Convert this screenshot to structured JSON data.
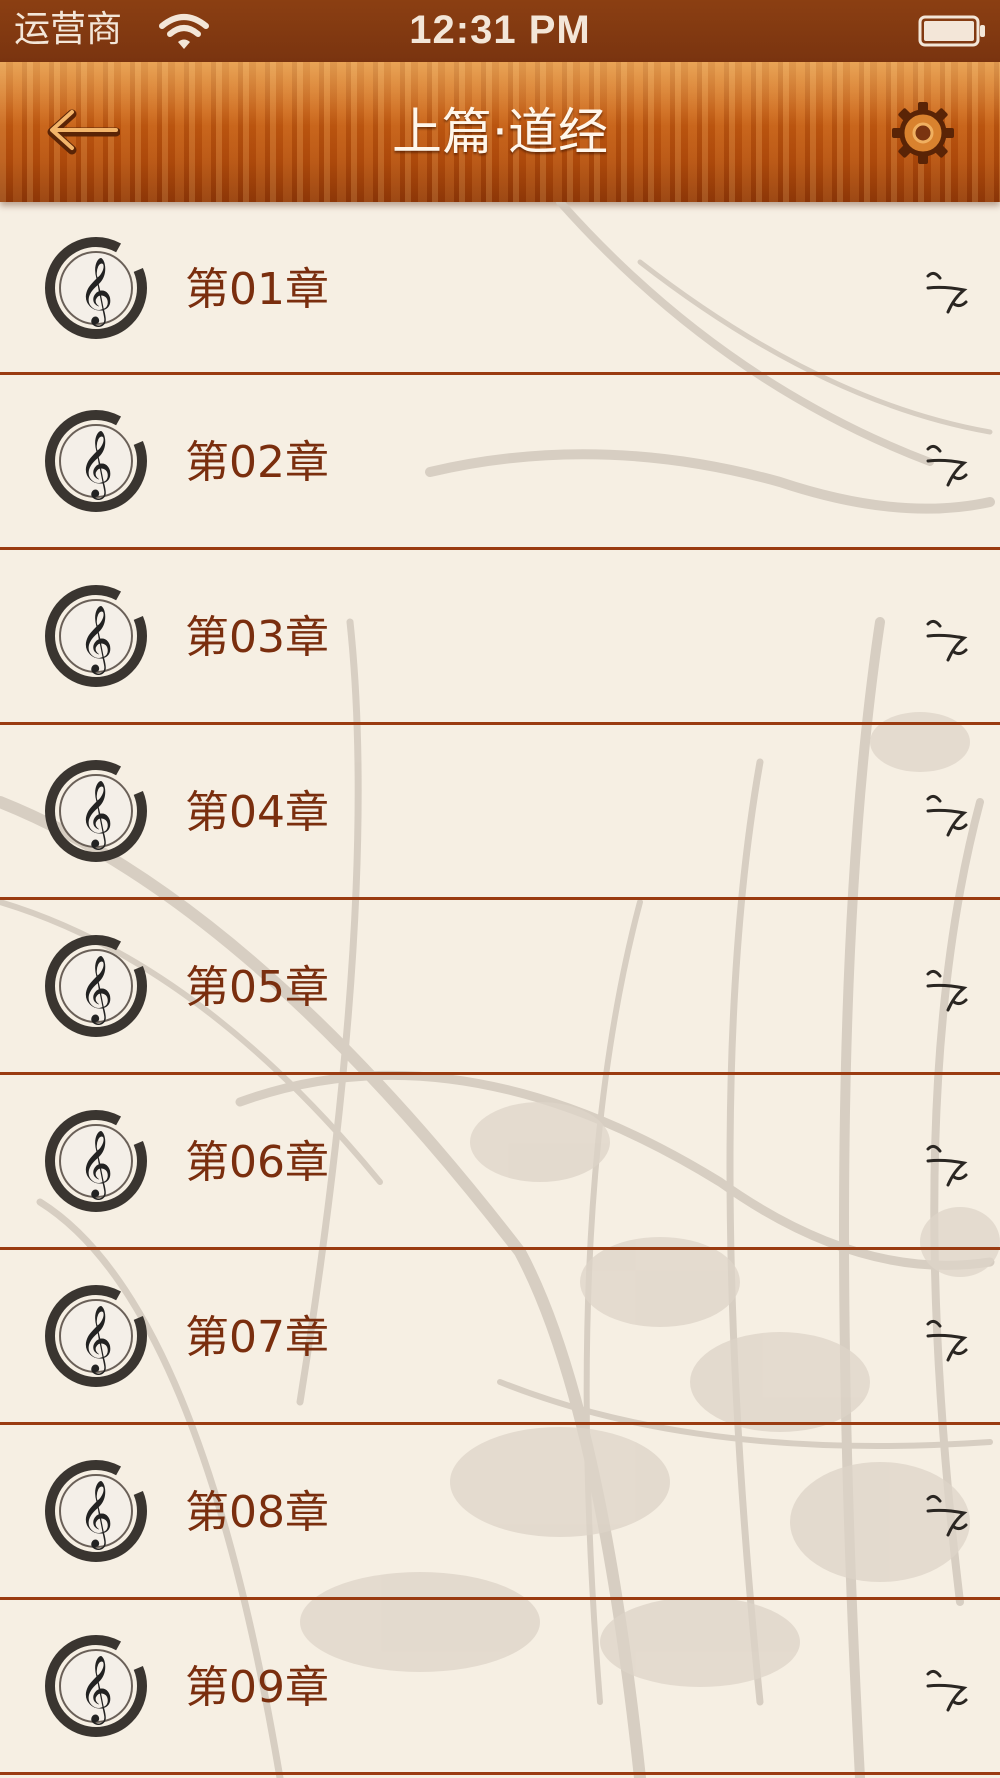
{
  "status_bar": {
    "carrier": "运营商",
    "time": "12:31 PM"
  },
  "navbar": {
    "title": "上篇·道经",
    "back_icon": "back-arrow-icon",
    "settings_icon": "gear-icon"
  },
  "chapters": [
    {
      "label": "第01章"
    },
    {
      "label": "第02章"
    },
    {
      "label": "第03章"
    },
    {
      "label": "第04章"
    },
    {
      "label": "第05章"
    },
    {
      "label": "第06章"
    },
    {
      "label": "第07章"
    },
    {
      "label": "第08章"
    },
    {
      "label": "第09章"
    }
  ],
  "colors": {
    "status_bar": "#7a3410",
    "nav_wood": "#c85f13",
    "background": "#f6efe3",
    "divider": "#9a3b11",
    "chapter_text": "#7a2e0e"
  }
}
